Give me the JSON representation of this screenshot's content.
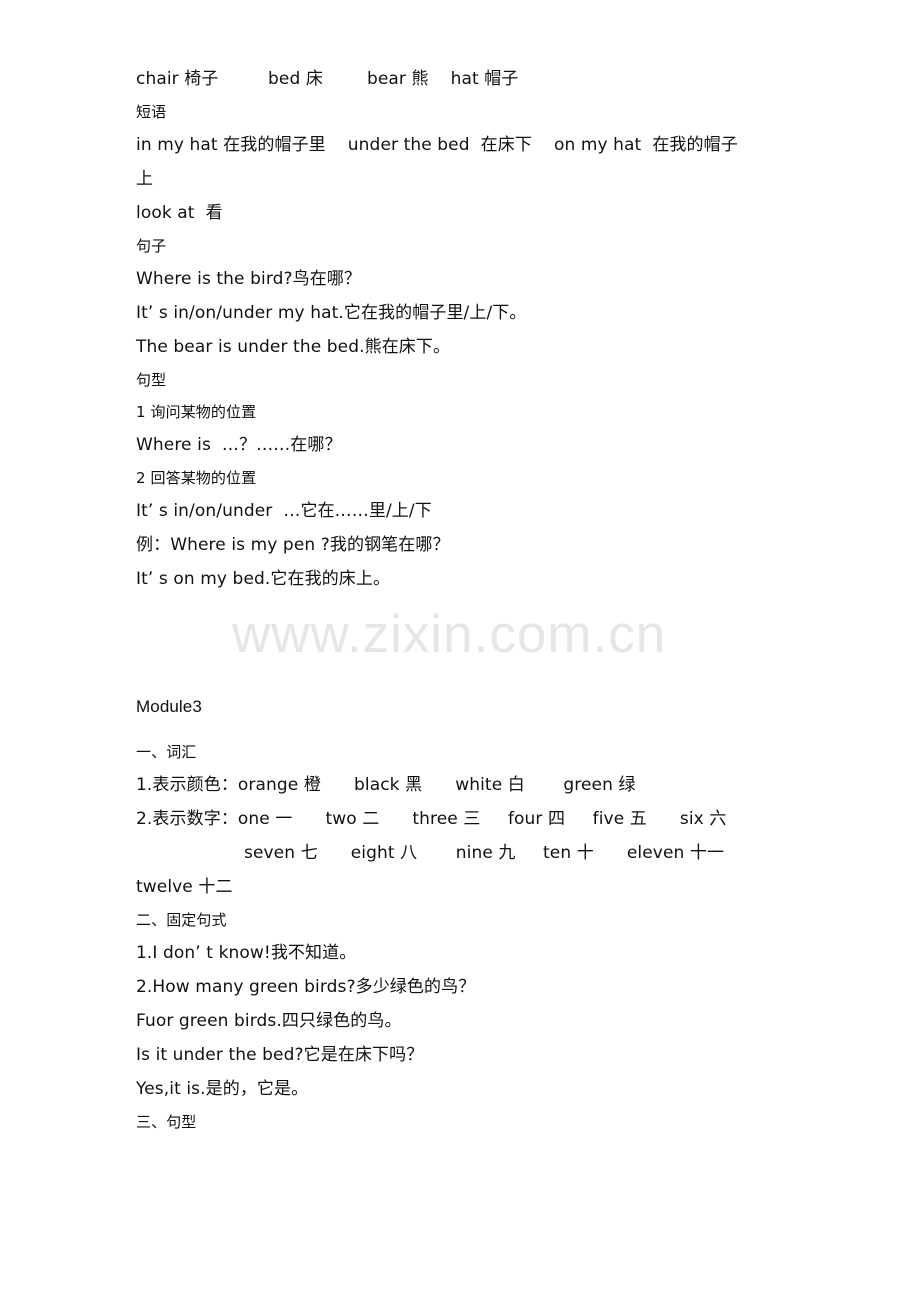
{
  "document": {
    "watermark": "www.zixin.com.cn",
    "page_background": "#ffffff",
    "text_color": "#111111",
    "watermark_color": "#e6e6e6"
  },
  "module2_tail": {
    "vocabulary_line": "chair 椅子         bed 床        bear 熊    hat 帽子",
    "phrases_heading": "短语",
    "phrases_line": "in my hat 在我的帽子里    under the bed  在床下    on my hat  在我的帽子",
    "phrases_wrap": "上",
    "look_at": "look at  看",
    "sentences_heading": "句子",
    "sentences": [
      "Where is the bird?鸟在哪？",
      "It’ s in/on/under my hat.它在我的帽子里/上/下。",
      "The bear is under the bed.熊在床下。"
    ],
    "patterns_heading": "句型",
    "pattern_1_label": "1 询问某物的位置",
    "pattern_1_text": "Where is  …？……在哪？",
    "pattern_2_label": "2 回答某物的位置",
    "pattern_2_text": "It’ s in/on/under  …它在……里/上/下",
    "example_question": "例：Where is my pen ?我的钢笔在哪？",
    "example_answer": "It’ s on my bed.它在我的床上。"
  },
  "module3": {
    "title": "Module3",
    "section_1_heading": "一、词汇",
    "colors_line": "1.表示颜色：orange 橙      black 黑      white 白       green 绿",
    "numbers_line_1": "2.表示数字：one 一      two 二      three 三     four 四     five 五      six 六",
    "numbers_line_2": "seven 七      eight 八       nine 九     ten 十      eleven 十一",
    "numbers_line_3": "twelve 十二",
    "section_2_heading": "二、固定句式",
    "fixed_1": "1.I don’ t know!我不知道。",
    "fixed_2": "2.How many green birds?多少绿色的鸟？",
    "fixed_2_answer": "Fuor green birds.四只绿色的鸟。",
    "fixed_3": "Is it under the bed?它是在床下吗？",
    "fixed_3_answer": "Yes,it is.是的，它是。",
    "section_3_heading": "三、句型"
  }
}
